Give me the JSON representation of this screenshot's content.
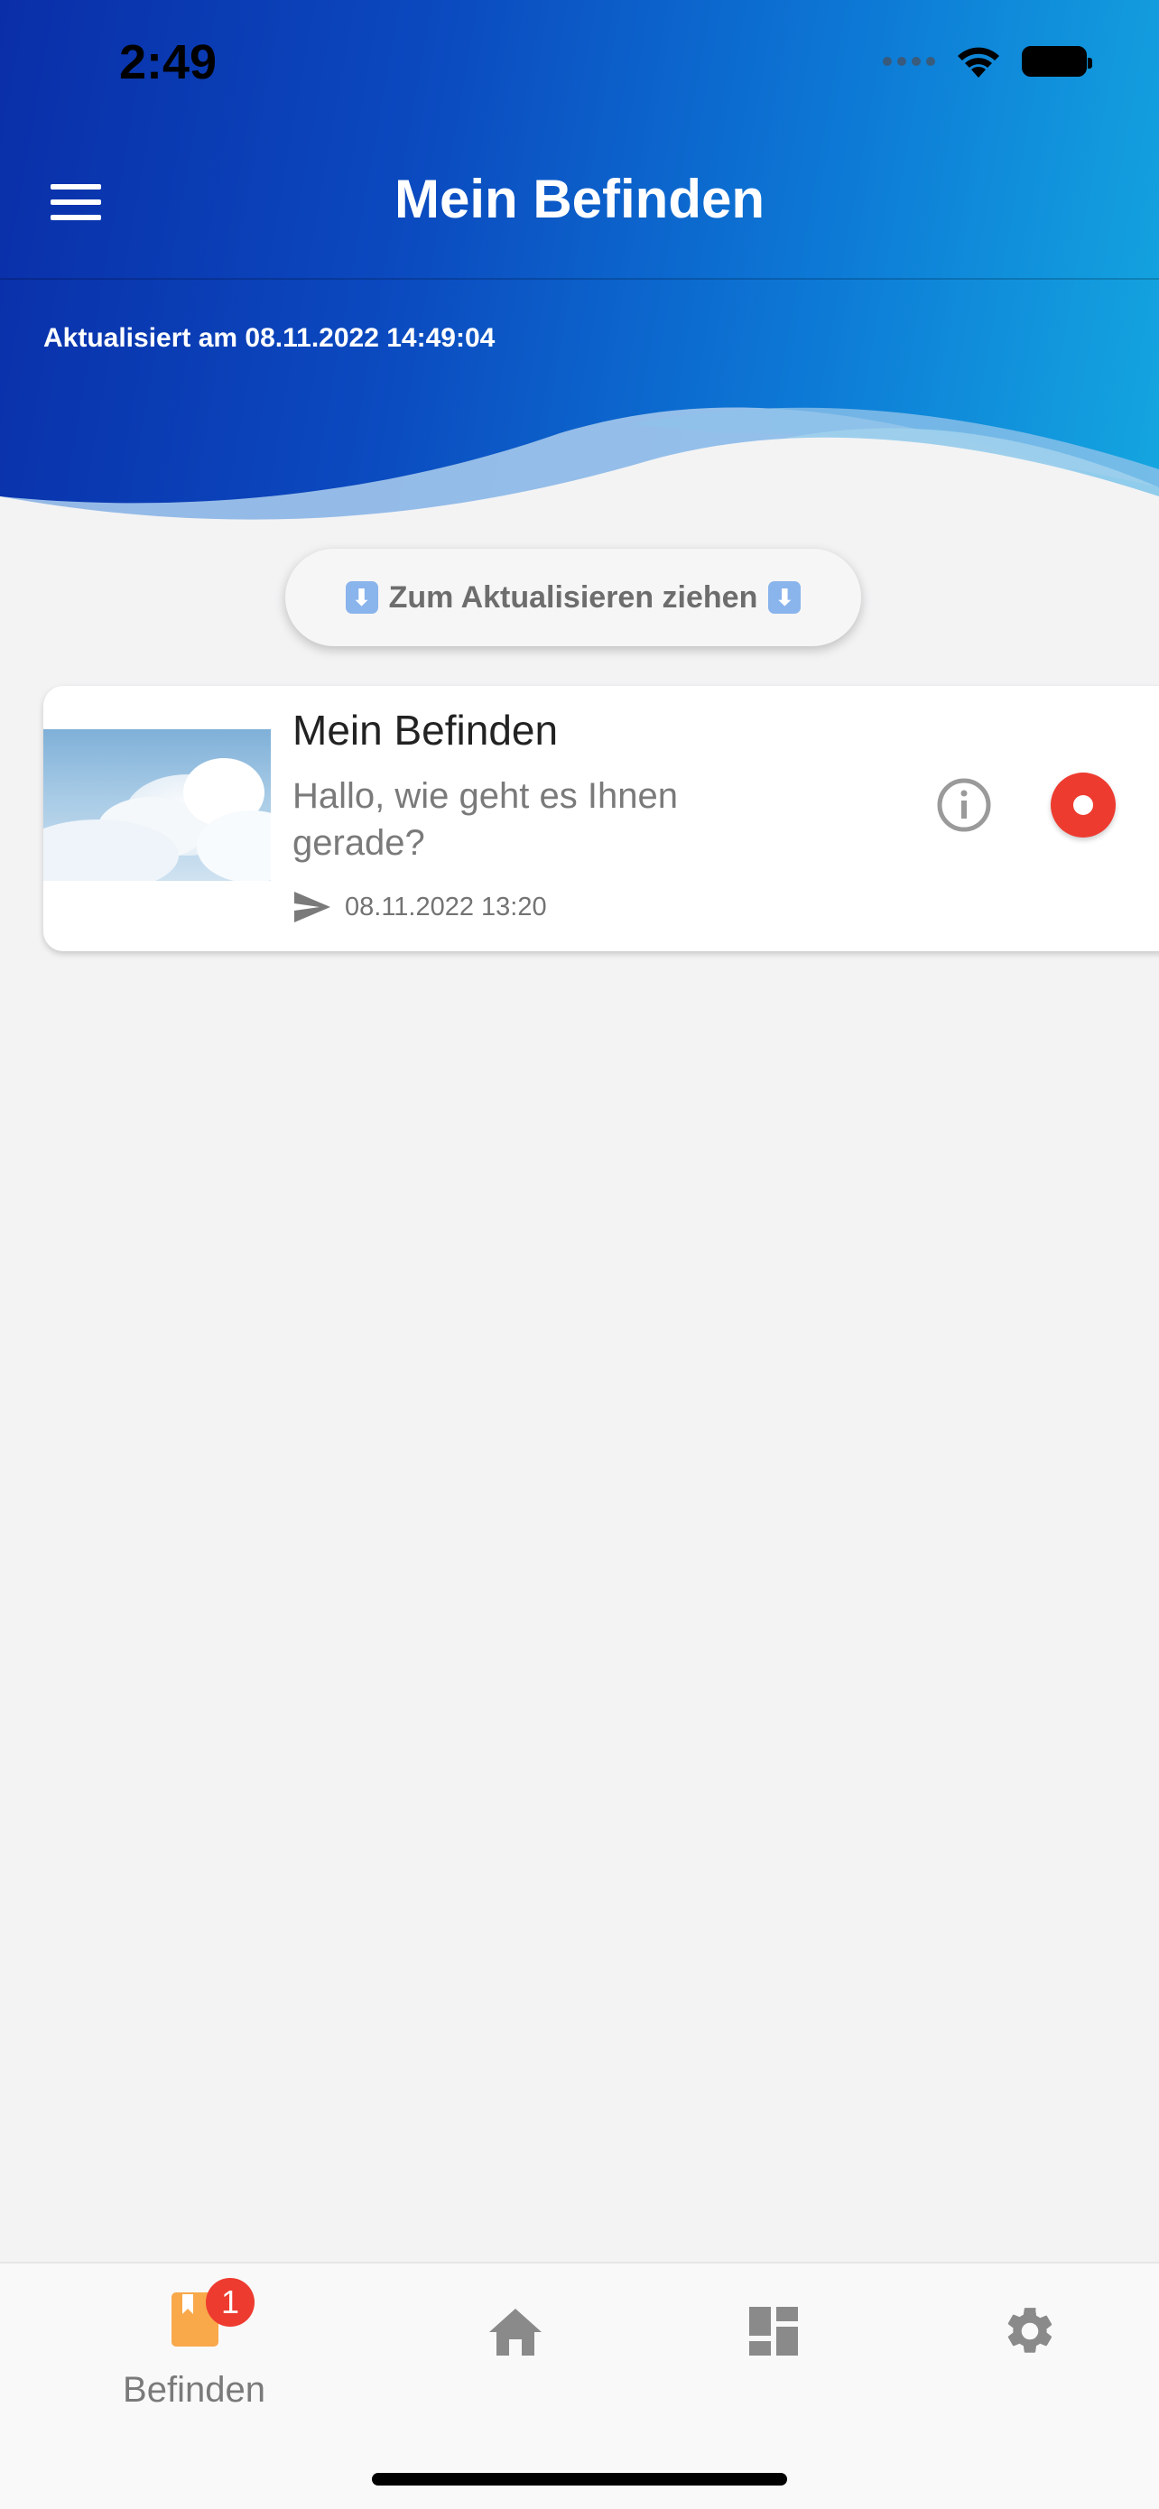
{
  "status_bar": {
    "time": "2:49"
  },
  "header": {
    "title": "Mein Befinden",
    "updated_text": "Aktualisiert am 08.11.2022 14:49:04"
  },
  "pull_to_refresh": {
    "label": "Zum Aktualisieren ziehen",
    "arrow_icon": "⬇"
  },
  "card": {
    "title": "Mein Befinden",
    "message": "Hallo, wie geht es Ihnen gerade?",
    "timestamp": "08.11.2022 13:20"
  },
  "bottom_nav": {
    "items": [
      {
        "label": "Befinden",
        "icon": "bookmark-icon",
        "badge": "1",
        "active": true
      },
      {
        "label": "",
        "icon": "home-icon"
      },
      {
        "label": "",
        "icon": "dashboard-icon"
      },
      {
        "label": "",
        "icon": "gear-icon"
      }
    ]
  },
  "colors": {
    "header_start": "#0a2ea8",
    "header_end": "#14a7e0",
    "accent_red": "#ee3b2f",
    "active_orange": "#f9a84a",
    "icon_gray": "#8a8a8a"
  }
}
